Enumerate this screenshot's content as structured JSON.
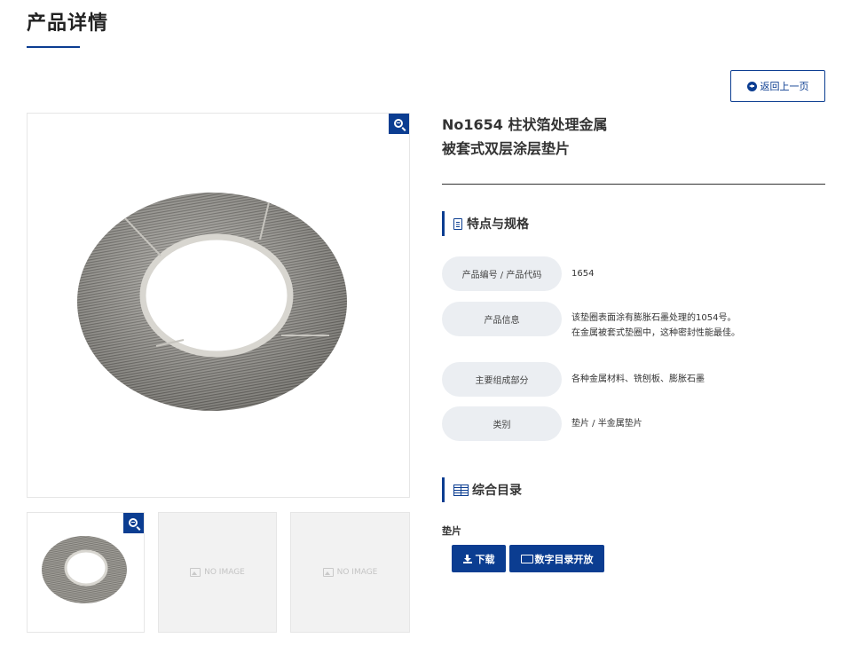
{
  "page": {
    "title": "产品详情"
  },
  "nav": {
    "back_label": "返回上一页"
  },
  "product": {
    "name_line1": "No1654 柱状箔处理金属",
    "name_line2": "被套式双层涂层垫片"
  },
  "spec_section": {
    "title": "特点与规格",
    "rows": [
      {
        "label": "产品编号 / 产品代码",
        "value": "1654"
      },
      {
        "label": "产品信息",
        "value_line1": "该垫圈表面涂有膨胀石墨处理的1054号。",
        "value_line2": "在金属被套式垫圈中，这种密封性能最佳。"
      },
      {
        "label": "主要组成部分",
        "value": "各种金属材料、铣刨板、膨胀石墨"
      },
      {
        "label": "类别",
        "value": "垫片 / 半金属垫片"
      }
    ]
  },
  "catalog_section": {
    "title": "综合目录",
    "subtitle": "垫片",
    "download_label": "下载",
    "digital_label": "数字目录开放"
  },
  "thumbnails": {
    "noimage_text": "NO IMAGE"
  },
  "colors": {
    "accent": "#0b3d91",
    "label_bg": "#ebeef2"
  },
  "icons": [
    "arrow-circle-left-icon",
    "zoom-in-icon",
    "document-icon",
    "book-icon",
    "download-icon",
    "monitor-icon",
    "image-placeholder-icon"
  ]
}
